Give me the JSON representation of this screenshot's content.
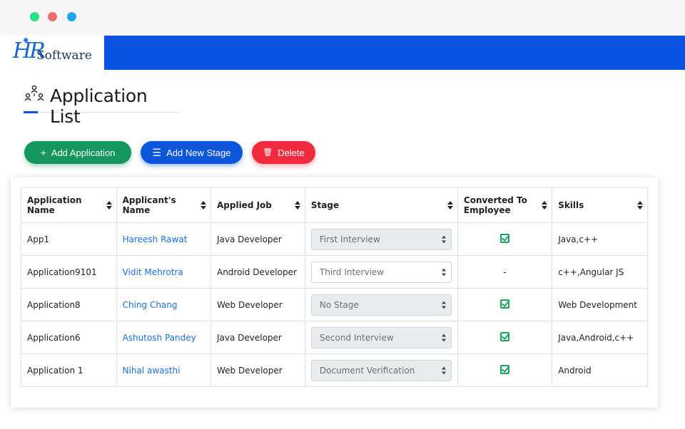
{
  "window": {
    "controls": [
      "green",
      "red",
      "blue"
    ]
  },
  "header": {
    "logo_hr": "HR",
    "logo_text": "Software"
  },
  "page": {
    "title": "Application List",
    "title_icon": "people-hierarchy-icon"
  },
  "toolbar": {
    "add_application": "Add Application",
    "add_new_stage": "Add New Stage",
    "delete": "Delete"
  },
  "table": {
    "columns": [
      "Application Name",
      "Applicant's Name",
      "Applied Job",
      "Stage",
      "Converted To Employee",
      "Skills"
    ],
    "rows": [
      {
        "application_name": "App1",
        "applicant": "Hareesh Rawat",
        "job": "Java Developer",
        "stage": "First Interview",
        "stage_enabled": false,
        "converted": true,
        "converted_text": "",
        "skills": "Java,c++"
      },
      {
        "application_name": "Application9101",
        "applicant": "Vidit Mehrotra",
        "job": "Android Developer",
        "stage": "Third Interview",
        "stage_enabled": true,
        "converted": false,
        "converted_text": "-",
        "skills": "c++,Angular JS"
      },
      {
        "application_name": "Application8",
        "applicant": "Ching Chang",
        "job": "Web Developer",
        "stage": "No Stage",
        "stage_enabled": false,
        "converted": true,
        "converted_text": "",
        "skills": "Web Development"
      },
      {
        "application_name": "Application6",
        "applicant": "Ashutosh Pandey",
        "job": "Java Developer",
        "stage": "Second Interview",
        "stage_enabled": false,
        "converted": true,
        "converted_text": "",
        "skills": "Java,Android,c++"
      },
      {
        "application_name": "Application 1",
        "applicant": "Nihal awasthi",
        "job": "Web Developer",
        "stage": "Document Verification",
        "stage_enabled": false,
        "converted": true,
        "converted_text": "",
        "skills": "Android"
      }
    ]
  },
  "colors": {
    "brand_blue": "#0a52e0",
    "add_green": "#14975f",
    "delete_red": "#f12b3d",
    "link_blue": "#1a6ed8",
    "check_green": "#18a558"
  }
}
